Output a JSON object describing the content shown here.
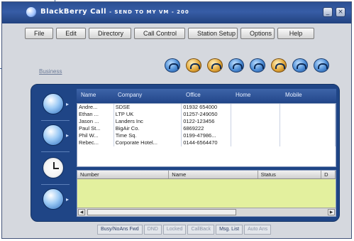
{
  "window": {
    "title": "BlackBerry Call",
    "subtitle": "- SEND TO MY VM - 200",
    "btn_minimize": "_",
    "btn_close": "×"
  },
  "menu": [
    {
      "label": "File",
      "name": "menu-file"
    },
    {
      "label": "Edit",
      "name": "menu-edit"
    },
    {
      "label": "Directory",
      "name": "menu-directory"
    },
    {
      "label": "Call Control",
      "name": "menu-call-control"
    },
    {
      "label": "Station Setup",
      "name": "menu-station-setup"
    },
    {
      "label": "Options",
      "name": "menu-options"
    },
    {
      "label": "Help",
      "name": "menu-help"
    }
  ],
  "toolbar": {
    "label": "Business",
    "icons": [
      {
        "name": "call-icon",
        "kind": "phone",
        "caption": ""
      },
      {
        "name": "contact-icon",
        "kind": "person",
        "caption": ""
      },
      {
        "name": "contact-add-icon",
        "kind": "person",
        "caption": ""
      },
      {
        "name": "transfer-icon",
        "kind": "phone",
        "caption": ""
      },
      {
        "name": "hold-icon",
        "kind": "phone",
        "caption": ""
      },
      {
        "name": "conference-icon",
        "kind": "person",
        "caption": ""
      },
      {
        "name": "hangup-icon",
        "kind": "phone",
        "caption": ""
      },
      {
        "name": "forward-icon",
        "kind": "phone",
        "caption": ""
      }
    ]
  },
  "contacts": {
    "headers": [
      "Name",
      "Company",
      "Office",
      "Home",
      "Mobile"
    ],
    "rows": [
      [
        "Andre...",
        "SDSE",
        "01932 654000",
        "",
        ""
      ],
      [
        "Ethan ...",
        "LTP UK",
        "01257-249050",
        "",
        ""
      ],
      [
        "Jason ...",
        "Landers Inc",
        "0122-123456",
        "",
        ""
      ],
      [
        "Paul St...",
        "BigAir Co.",
        "6869222",
        "",
        ""
      ],
      [
        "Phil W...",
        "Time Sq.",
        "0199-47986...",
        "",
        ""
      ],
      [
        "Rebec...",
        "Corporate Hotel...",
        "0144-6564470",
        "",
        ""
      ]
    ]
  },
  "calls": {
    "headers": [
      "Number",
      "Name",
      "Status",
      "D"
    ]
  },
  "sidebar": {
    "items": [
      {
        "name": "sidebar-directory-icon",
        "kind": "phone"
      },
      {
        "name": "sidebar-contacts-icon",
        "kind": "phone"
      },
      {
        "name": "sidebar-history-icon",
        "kind": "clock"
      },
      {
        "name": "sidebar-calls-icon",
        "kind": "phone"
      }
    ]
  },
  "statusbar": [
    {
      "label": "Busy/NoAns Fwd",
      "active": true
    },
    {
      "label": "DND",
      "active": false
    },
    {
      "label": "Locked",
      "active": false
    },
    {
      "label": "CallBack",
      "active": false
    },
    {
      "label": "Msg. List",
      "active": true
    },
    {
      "label": "Auto Ans",
      "active": false
    }
  ]
}
